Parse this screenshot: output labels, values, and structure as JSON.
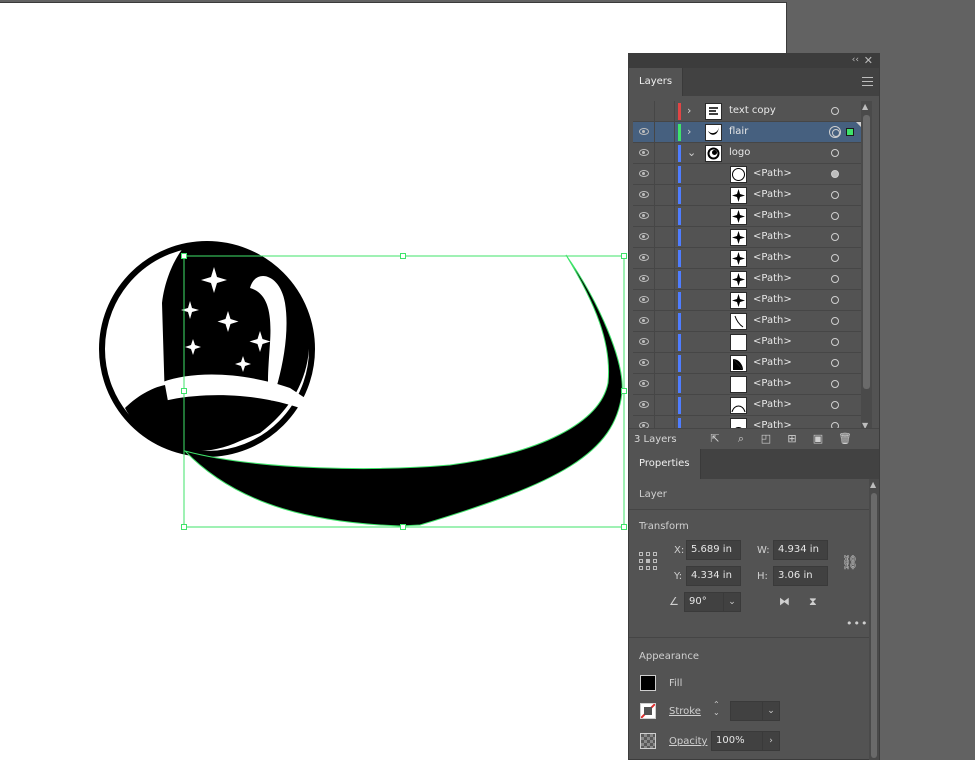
{
  "colors": {
    "panel_bg": "#535353",
    "selection_green": "#3fe36a",
    "selected_row": "#46607f",
    "layer_red": "#e04545",
    "layer_green": "#3fe36a",
    "layer_blue": "#4f7dff"
  },
  "layers_panel": {
    "tab_label": "Layers",
    "menu_icon": "hamburger-menu-icon",
    "collapse_icon": "double-chevron-left-icon",
    "close_icon": "close-icon",
    "layer_count": "3 Layers",
    "rows": [
      {
        "name": "text copy",
        "visible": false,
        "color": "#e04545",
        "expandable": true,
        "expanded": false,
        "indent": 0,
        "selected": false,
        "thumb": "text"
      },
      {
        "name": "flair",
        "visible": true,
        "color": "#3fe36a",
        "expandable": true,
        "expanded": false,
        "indent": 0,
        "selected": true,
        "thumb": "swoosh"
      },
      {
        "name": "logo",
        "visible": true,
        "color": "#4f7dff",
        "expandable": true,
        "expanded": true,
        "indent": 0,
        "selected": false,
        "thumb": "logo"
      },
      {
        "name": "<Path>",
        "visible": true,
        "color": "#4f7dff",
        "indent": 1,
        "thumb": "circle",
        "target_filled": true
      },
      {
        "name": "<Path>",
        "visible": true,
        "color": "#4f7dff",
        "indent": 1,
        "thumb": "star"
      },
      {
        "name": "<Path>",
        "visible": true,
        "color": "#4f7dff",
        "indent": 1,
        "thumb": "star"
      },
      {
        "name": "<Path>",
        "visible": true,
        "color": "#4f7dff",
        "indent": 1,
        "thumb": "star"
      },
      {
        "name": "<Path>",
        "visible": true,
        "color": "#4f7dff",
        "indent": 1,
        "thumb": "star"
      },
      {
        "name": "<Path>",
        "visible": true,
        "color": "#4f7dff",
        "indent": 1,
        "thumb": "star"
      },
      {
        "name": "<Path>",
        "visible": true,
        "color": "#4f7dff",
        "indent": 1,
        "thumb": "star"
      },
      {
        "name": "<Path>",
        "visible": true,
        "color": "#4f7dff",
        "indent": 1,
        "thumb": "line"
      },
      {
        "name": "<Path>",
        "visible": true,
        "color": "#4f7dff",
        "indent": 1,
        "thumb": "blank"
      },
      {
        "name": "<Path>",
        "visible": true,
        "color": "#4f7dff",
        "indent": 1,
        "thumb": "wedge"
      },
      {
        "name": "<Path>",
        "visible": true,
        "color": "#4f7dff",
        "indent": 1,
        "thumb": "blank"
      },
      {
        "name": "<Path>",
        "visible": true,
        "color": "#4f7dff",
        "indent": 1,
        "thumb": "arc"
      },
      {
        "name": "<Path>",
        "visible": true,
        "color": "#4f7dff",
        "indent": 1,
        "thumb": "half"
      }
    ],
    "footer_icons": [
      "collect-for-export-icon",
      "locate-object-icon",
      "clipping-mask-icon",
      "new-sublayer-icon",
      "new-layer-icon",
      "delete-icon"
    ]
  },
  "properties_panel": {
    "tab_label": "Properties",
    "context_label": "Layer",
    "transform": {
      "section_label": "Transform",
      "x_label": "X:",
      "x_value": "5.689 in",
      "y_label": "Y:",
      "y_value": "4.334 in",
      "w_label": "W:",
      "w_value": "4.934 in",
      "h_label": "H:",
      "h_value": "3.06 in",
      "rotate_value": "90°"
    },
    "appearance": {
      "section_label": "Appearance",
      "fill_label": "Fill",
      "stroke_label": "Stroke",
      "opacity_label": "Opacity",
      "opacity_value": "100%"
    }
  }
}
